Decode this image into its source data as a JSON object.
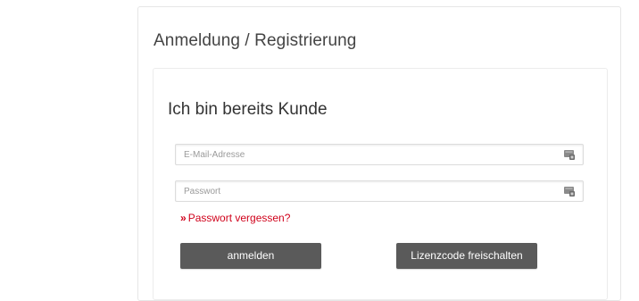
{
  "page": {
    "title": "Anmeldung / Registrierung"
  },
  "login": {
    "heading": "Ich bin bereits Kunde",
    "email_placeholder": "E-Mail-Adresse",
    "password_placeholder": "Passwort",
    "forgot_chevron": "»",
    "forgot_label": "Passwort vergessen?",
    "login_button": "anmelden",
    "license_button": "Lizenzcode freischalten"
  },
  "icons": {
    "field_icon": "password-manager-icon"
  },
  "colors": {
    "link": "#d0021b",
    "button_bg": "#5a5a5a",
    "button_text": "#ffffff"
  }
}
